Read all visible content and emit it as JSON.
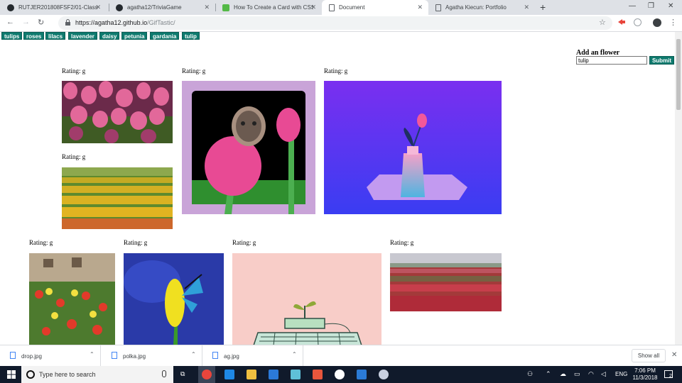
{
  "browser": {
    "tabs": [
      {
        "title": "RUTJER201808FSF2/01-Class-Co",
        "icon": "github-icon"
      },
      {
        "title": "agatha12/TriviaGame",
        "icon": "github-icon"
      },
      {
        "title": "How To Create a Card with CSS",
        "icon": "codecademy-icon"
      },
      {
        "title": "Document",
        "icon": "document-icon",
        "active": true
      },
      {
        "title": "Agatha Kiecun: Portfolio",
        "icon": "document-icon"
      }
    ],
    "url_host": "https://agatha12.github.io",
    "url_path": "/GifTastic/"
  },
  "topics": [
    "tulips",
    "roses",
    "lilacs",
    "lavender",
    "daisy",
    "petunia",
    "gardania",
    "tulip"
  ],
  "form": {
    "title": "Add an flower",
    "input_value": "tulip",
    "submit_label": "Submit"
  },
  "gifs": [
    {
      "rating": "Rating: g",
      "subject": "pink tulip field"
    },
    {
      "rating": "Rating: g",
      "subject": "face in pink tulips"
    },
    {
      "rating": "Rating: g",
      "subject": "tulip in vase on purple"
    },
    {
      "rating": "Rating: g",
      "subject": "yellow tulip field"
    },
    {
      "rating": "Rating: g",
      "subject": "garden tulips"
    },
    {
      "rating": "Rating: g",
      "subject": "yellow tulip with butterfly"
    },
    {
      "rating": "Rating: g",
      "subject": "sprout on keyboard"
    },
    {
      "rating": "Rating: g",
      "subject": "red tulip field"
    }
  ],
  "downloads": {
    "items": [
      "drop.jpg",
      "polka.jpg",
      "ag.jpg"
    ],
    "show_all": "Show all"
  },
  "taskbar": {
    "search_placeholder": "Type here to search",
    "language": "ENG",
    "time": "7:06 PM",
    "date": "11/3/2018",
    "notification_count": "2"
  },
  "colors": {
    "button_bg": "#0e7a6e",
    "tab_bar": "#dee1e6",
    "taskbar": "#101a2b"
  }
}
